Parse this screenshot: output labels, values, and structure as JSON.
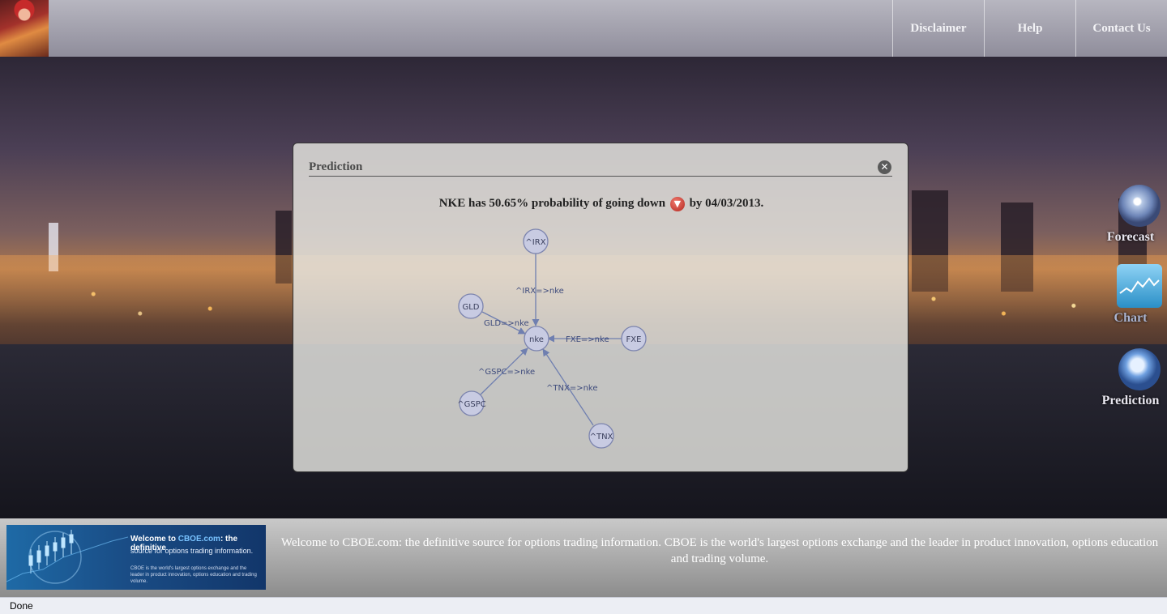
{
  "nav": {
    "items": [
      {
        "label": "Disclaimer"
      },
      {
        "label": "Help"
      },
      {
        "label": "Contact Us"
      }
    ]
  },
  "side_tools": [
    {
      "label": "Forecast",
      "icon": "forecast-icon"
    },
    {
      "label": "Chart",
      "icon": "chart-icon"
    },
    {
      "label": "Prediction",
      "icon": "magnifier-icon"
    }
  ],
  "dialog": {
    "title": "Prediction",
    "close_icon": "close-icon",
    "headline_before": "NKE has 50.65% probability of going down",
    "headline_after": "by 04/03/2013.",
    "direction_icon": "down-arrow-icon"
  },
  "graph": {
    "nodes": [
      {
        "id": "^IRX"
      },
      {
        "id": "GLD"
      },
      {
        "id": "nke"
      },
      {
        "id": "FXE"
      },
      {
        "id": "^GSPC"
      },
      {
        "id": "^TNX"
      }
    ],
    "edges": [
      {
        "label": "^IRX=>nke"
      },
      {
        "label": "GLD=>nke"
      },
      {
        "label": "FXE=>nke"
      },
      {
        "label": "^GSPC=>nke"
      },
      {
        "label": "^TNX=>nke"
      }
    ]
  },
  "footer": {
    "ad": {
      "head_prefix": "Welcome to ",
      "head_brand": "CBOE.com",
      "head_suffix": ": the definitive",
      "sub": "source for options trading information.",
      "small": "CBOE is the world's largest options exchange and the leader in product innovation, options education and trading volume."
    },
    "text": "Welcome to CBOE.com: the definitive source for options trading information. CBOE is the world's largest options exchange and the leader in product innovation, options education and trading volume."
  },
  "status": {
    "text": "Done"
  },
  "colors": {
    "node_fill": "#c8cbe2",
    "edge": "#6f7fb0",
    "down": "#c0392b"
  }
}
